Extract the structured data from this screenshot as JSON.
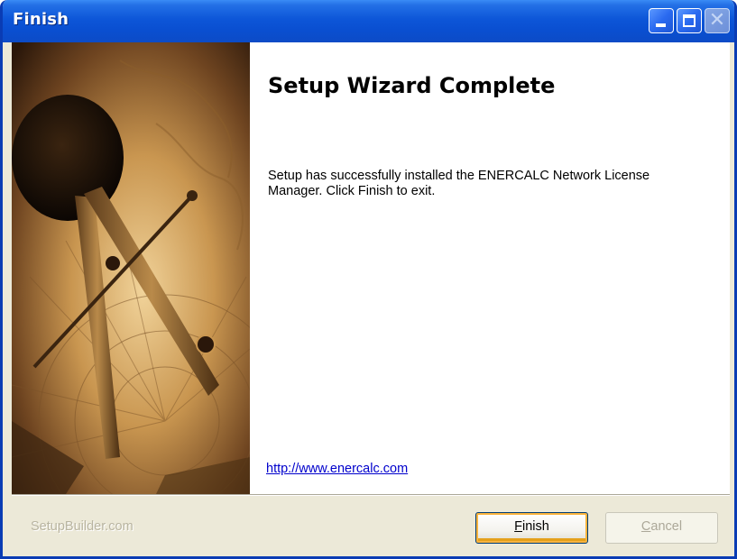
{
  "window": {
    "title": "Finish",
    "controls": {
      "minimize_icon": "minimize-icon",
      "maximize_icon": "maximize-icon",
      "close_icon": "close-icon",
      "close_glyph": "✕"
    }
  },
  "side_image": {
    "description_icon": "compass-map-artwork"
  },
  "main": {
    "heading": "Setup Wizard Complete",
    "description": "Setup has successfully installed the ENERCALC Network License Manager. Click Finish to exit.",
    "link": "http://www.enercalc.com"
  },
  "footer": {
    "brand": "SetupBuilder.com",
    "finish_button": {
      "mnemonic": "F",
      "rest": "inish",
      "enabled": true
    },
    "cancel_button": {
      "mnemonic": "C",
      "rest": "ancel",
      "enabled": false
    }
  },
  "colors": {
    "titlebar": "#0a4fd1",
    "face": "#ece9d8",
    "link": "#0000cc",
    "focus_ring": "#f9b33d"
  }
}
